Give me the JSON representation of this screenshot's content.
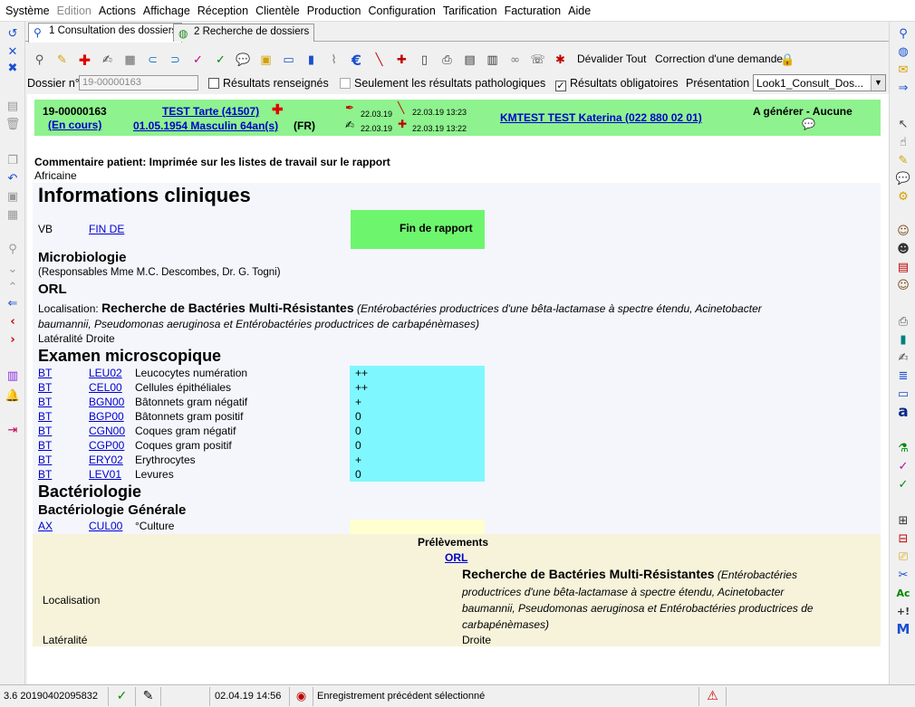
{
  "menu": [
    "Système",
    "Edition",
    "Actions",
    "Affichage",
    "Réception",
    "Clientèle",
    "Production",
    "Configuration",
    "Tarification",
    "Facturation",
    "Aide"
  ],
  "tabs": [
    {
      "label": "1 Consultation des dossiers"
    },
    {
      "label": "2 Recherche de dossiers"
    }
  ],
  "toolbar": {
    "devalider": "Dévalider Tout",
    "correction": "Correction d'une demande"
  },
  "options": {
    "dossier_label": "Dossier n°",
    "dossier_value": "19-00000163",
    "resultats_renseignes": "Résultats renseignés",
    "seulement_patho": "Seulement les résultats pathologiques",
    "resultats_obligatoires": "Résultats obligatoires",
    "presentation_label": "Présentation",
    "presentation_value": "Look1_Consult_Dos..."
  },
  "patient": {
    "dossier": "19-00000163",
    "statut": "(En cours)",
    "nom": "TEST Tarte (41507)",
    "naissance": "01.05.1954 Masculin 64an(s)",
    "pays": "(FR)",
    "date1": "22.03.19",
    "date2": "22.03.19",
    "date3": "22.03.19 13:23",
    "date4": "22.03.19 13:22",
    "medecin": "KMTEST TEST Katerina (022 880 02 01)",
    "a_generer": "A générer - Aucune"
  },
  "commentaire": {
    "titre": "Commentaire patient: Imprimée sur les listes de travail sur le rapport",
    "valeur": "Africaine"
  },
  "report": {
    "titre": "Informations cliniques",
    "vb": "VB",
    "fin_de": "FIN DE",
    "fin_rapport": "Fin de rapport",
    "microbiologie": "Microbiologie",
    "responsables": "(Responsables Mme M.C. Descombes, Dr. G. Togni)",
    "orl": "ORL",
    "localisation_label": "Localisation:",
    "localisation_titre": "Recherche de Bactéries Multi-Résistantes",
    "localisation_detail_1": "(Entérobactéries productrices d'une bêta-lactamase à spectre étendu, Acinetobacter",
    "localisation_detail_2": "baumannii, Pseudomonas aeruginosa et Entérobactéries productrices de carbapénèmases)",
    "lateralite": "Latéralité Droite",
    "examen": "Examen microscopique",
    "rows": [
      {
        "bt": "BT",
        "code": "LEU02",
        "label": "Leucocytes numération",
        "value": "++"
      },
      {
        "bt": "BT",
        "code": "CEL00",
        "label": "Cellules épithéliales",
        "value": "++"
      },
      {
        "bt": "BT",
        "code": "BGN00",
        "label": "Bâtonnets gram négatif",
        "value": "+"
      },
      {
        "bt": "BT",
        "code": "BGP00",
        "label": "Bâtonnets gram positif",
        "value": "0"
      },
      {
        "bt": "BT",
        "code": "CGN00",
        "label": "Coques gram négatif",
        "value": "0"
      },
      {
        "bt": "BT",
        "code": "CGP00",
        "label": "Coques gram positif",
        "value": "0"
      },
      {
        "bt": "BT",
        "code": "ERY02",
        "label": "Erythrocytes",
        "value": "+"
      },
      {
        "bt": "BT",
        "code": "LEV01",
        "label": "Levures",
        "value": "0"
      }
    ],
    "bacteriologie": "Bactériologie",
    "bact_generale": "Bactériologie Générale",
    "culture": {
      "bt": "AX",
      "code": "CUL00",
      "label": "°Culture"
    }
  },
  "prelevements": {
    "titre": "Prélèvements",
    "orl": "ORL",
    "localisation": "Localisation",
    "texte_titre": "Recherche de Bactéries Multi-Résistantes",
    "texte_1": "(Entérobactéries",
    "texte_2": "productrices d'une bêta-lactamase à spectre étendu, Acinetobacter",
    "texte_3": "baumannii, Pseudomonas aeruginosa et Entérobactéries productrices de",
    "texte_4": "carbapénèmases)",
    "lateralite": "Latéralité",
    "droite": "Droite"
  },
  "status": {
    "version": "3.6 20190402095832",
    "datetime": "02.04.19 14:56",
    "message": "Enregistrement précédent sélectionné"
  },
  "colors": {
    "band": "#8ef28e",
    "cyan": "#7ff7ff",
    "link": "#0000cc",
    "prel": "#f6f3da"
  }
}
